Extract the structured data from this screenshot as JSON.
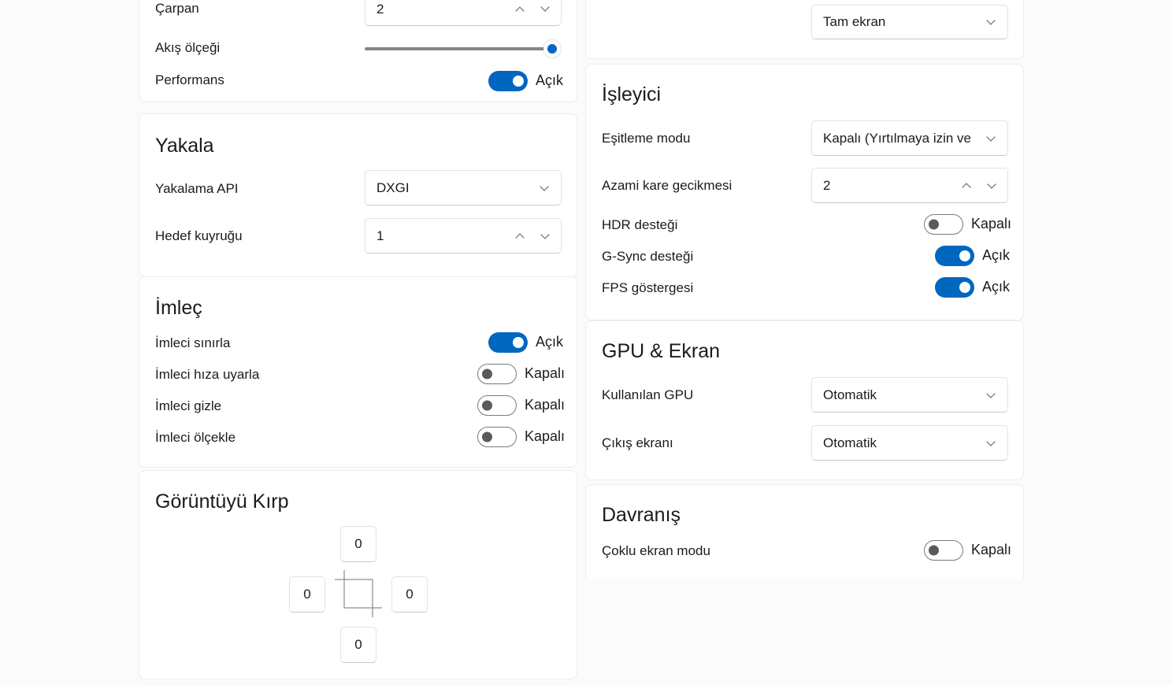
{
  "left_top": {
    "multiplier_label": "Çarpan",
    "multiplier_value": "2",
    "flow_scale_label": "Akış ölçeği",
    "flow_scale_level": 1.0,
    "performance_label": "Performans",
    "performance_state": "Açık"
  },
  "capture": {
    "title": "Yakala",
    "api_label": "Yakalama API",
    "api_value": "DXGI",
    "queue_label": "Hedef kuyruğu",
    "queue_value": "1"
  },
  "cursor": {
    "title": "İmleç",
    "items": [
      {
        "label": "İmleci sınırla",
        "state": "Açık",
        "on": true
      },
      {
        "label": "İmleci hıza uyarla",
        "state": "Kapalı",
        "on": false
      },
      {
        "label": "İmleci gizle",
        "state": "Kapalı",
        "on": false
      },
      {
        "label": "İmleci ölçekle",
        "state": "Kapalı",
        "on": false
      }
    ]
  },
  "crop": {
    "title": "Görüntüyü Kırp",
    "top": "0",
    "left": "0",
    "right": "0",
    "bottom": "0"
  },
  "right_top": {
    "display_mode_value": "Tam ekran"
  },
  "renderer": {
    "title": "İşleyici",
    "sync_label": "Eşitleme modu",
    "sync_value": "Kapalı (Yırtılmaya izin ve",
    "latency_label": "Azami kare gecikmesi",
    "latency_value": "2",
    "hdr_label": "HDR desteği",
    "hdr_state": "Kapalı",
    "gsync_label": "G-Sync desteği",
    "gsync_state": "Açık",
    "fps_label": "FPS göstergesi",
    "fps_state": "Açık"
  },
  "gpu": {
    "title": "GPU & Ekran",
    "gpu_label": "Kullanılan GPU",
    "gpu_value": "Otomatik",
    "output_label": "Çıkış ekranı",
    "output_value": "Otomatik"
  },
  "behavior": {
    "title": "Davranış",
    "multi_label": "Çoklu ekran modu",
    "multi_state": "Kapalı"
  },
  "colors": {
    "accent": "#0067c0",
    "background": "#fbfbfb",
    "card": "#ffffff"
  }
}
